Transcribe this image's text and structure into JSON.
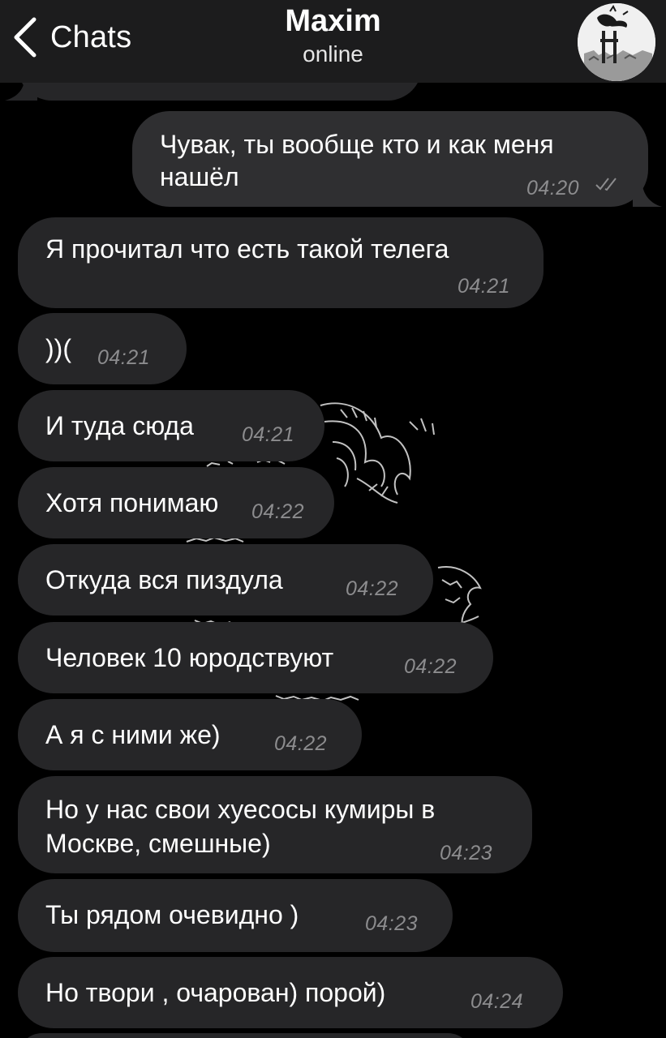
{
  "header": {
    "back_label": "Chats",
    "title": "Maxim",
    "status": "online"
  },
  "messages": [
    {
      "text_lines": [
        "Чувак, ты вообще кто и как меня",
        "нашёл"
      ],
      "time": "04:20",
      "direction": "outgoing",
      "status": "read"
    },
    {
      "text_lines": [
        "Я прочитал что есть такой телега"
      ],
      "time": "04:21",
      "direction": "incoming"
    },
    {
      "text_lines": [
        "))("
      ],
      "time": "04:21",
      "direction": "incoming"
    },
    {
      "text_lines": [
        "И туда сюда"
      ],
      "time": "04:21",
      "direction": "incoming"
    },
    {
      "text_lines": [
        "Хотя понимаю"
      ],
      "time": "04:22",
      "direction": "incoming"
    },
    {
      "text_lines": [
        "Откуда вся пиздула"
      ],
      "time": "04:22",
      "direction": "incoming"
    },
    {
      "text_lines": [
        "Человек 10 юродствуют"
      ],
      "time": "04:22",
      "direction": "incoming"
    },
    {
      "text_lines": [
        "А я с ними же)"
      ],
      "time": "04:22",
      "direction": "incoming"
    },
    {
      "text_lines": [
        "Но у нас свои хуесосы кумиры в",
        "Москве, смешные)"
      ],
      "time": "04:23",
      "direction": "incoming"
    },
    {
      "text_lines": [
        "Ты рядом очевидно )"
      ],
      "time": "04:23",
      "direction": "incoming"
    },
    {
      "text_lines": [
        "Но твори , очарован) порой)"
      ],
      "time": "04:24",
      "direction": "incoming"
    }
  ],
  "icons": {
    "back": "chevron-left-icon",
    "read_status": "double-check-icon",
    "wallpaper": "wave-illustration",
    "avatar": "contact-avatar"
  },
  "colors": {
    "background": "#000000",
    "header": "#1c1c1d",
    "bubble_incoming": "#262628",
    "bubble_outgoing": "#2f2f31",
    "time_text": "#8c8c8e"
  }
}
